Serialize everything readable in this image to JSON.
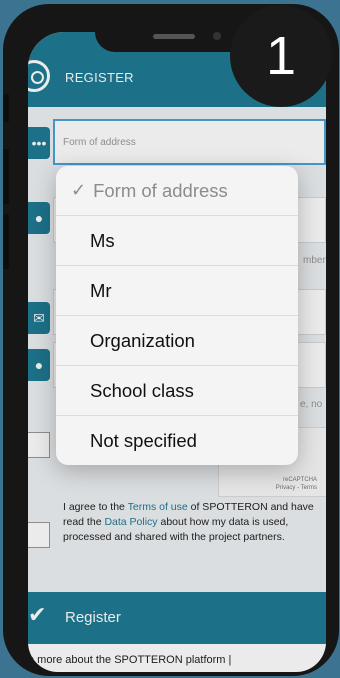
{
  "header": {
    "title": "REGISTER"
  },
  "form": {
    "form_of_address_placeholder": "Form of address",
    "hint_member": "mber",
    "hint_no": "e, no",
    "captcha_text": "Privacy - Terms",
    "captcha_brand": "reCAPTCHA"
  },
  "agreement": {
    "part1": "I agree to the ",
    "terms_link": "Terms of use",
    "part2": " of SPOTTERON and have read the ",
    "policy_link": "Data Policy",
    "part3": " about how my data is used, processed and shared with the project partners."
  },
  "register_button": {
    "label": "Register"
  },
  "footer": {
    "text": "n more about the SPOTTERON platform |"
  },
  "dropdown": {
    "selected": "Form of address",
    "options": [
      "Ms",
      "Mr",
      "Organization",
      "School class",
      "Not specified"
    ]
  },
  "badge": {
    "number": "1"
  },
  "colors": {
    "accent": "#1f7a93",
    "background": "#3b7390",
    "focus": "#4aa3d8"
  }
}
